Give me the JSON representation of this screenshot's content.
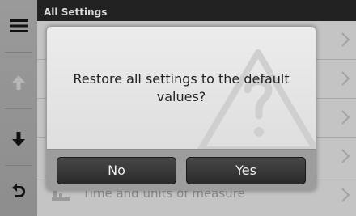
{
  "header": {
    "title": "All Settings"
  },
  "list": {
    "rows": [
      {
        "label": ""
      },
      {
        "label": ""
      },
      {
        "label": ""
      },
      {
        "label": ""
      },
      {
        "label": "Time and units of measure"
      }
    ]
  },
  "rail": {
    "icons": [
      "menu-icon",
      "arrow-up-icon",
      "arrow-down-icon",
      "back-icon"
    ]
  },
  "dialog": {
    "message": "Restore all settings to the default values?",
    "no_label": "No",
    "yes_label": "Yes"
  },
  "colors": {
    "button": "#333333",
    "modal": "#e6e6e6",
    "rail": "#969696",
    "list": "#c4c4c4"
  }
}
